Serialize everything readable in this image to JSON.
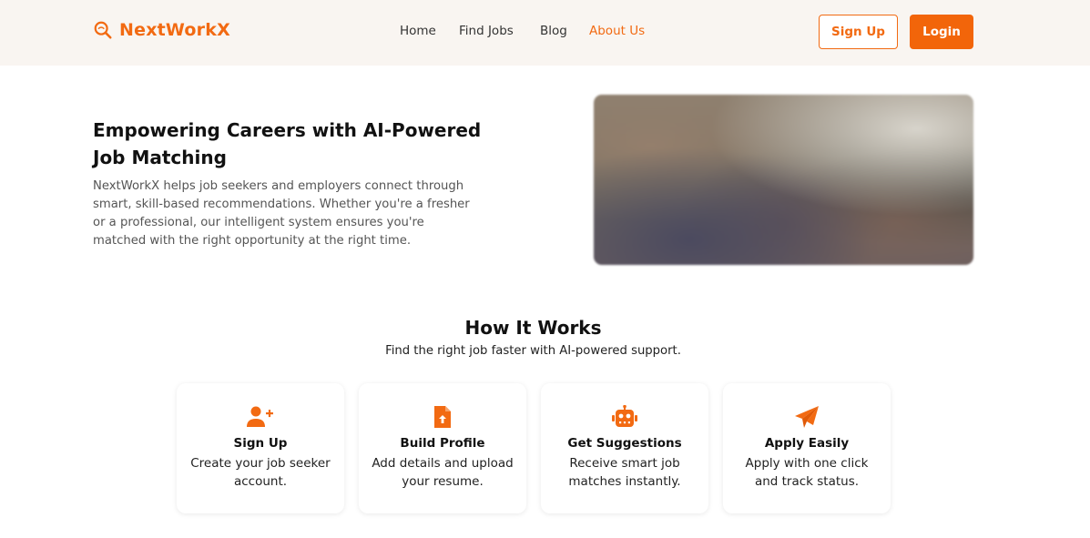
{
  "brand": {
    "name": "NextWorkX",
    "accent": "#f26a12",
    "icon": "search-icon"
  },
  "nav": {
    "home": "Home",
    "find_jobs": "Find Jobs",
    "blog": "Blog",
    "about": "About Us"
  },
  "auth": {
    "signup": "Sign Up",
    "login": "Login"
  },
  "hero": {
    "title": "Empowering Careers with AI-Powered Job Matching",
    "text": "NextWorkX helps job seekers and employers connect through smart, skill-based recommendations. Whether you're a fresher or a professional, our intelligent system ensures you're matched with the right opportunity at the right time."
  },
  "how_it_works": {
    "title": "How It Works",
    "subtitle": "Find the right job faster with AI-powered support.",
    "steps": [
      {
        "icon": "user-plus-icon",
        "title": "Sign Up",
        "desc": "Create your job seeker account."
      },
      {
        "icon": "file-upload-icon",
        "title": "Build Profile",
        "desc": "Add details and upload your resume."
      },
      {
        "icon": "robot-icon",
        "title": "Get Suggestions",
        "desc": "Receive smart job matches instantly."
      },
      {
        "icon": "paper-plane-icon",
        "title": "Apply Easily",
        "desc": "Apply with one click and track status."
      }
    ]
  }
}
